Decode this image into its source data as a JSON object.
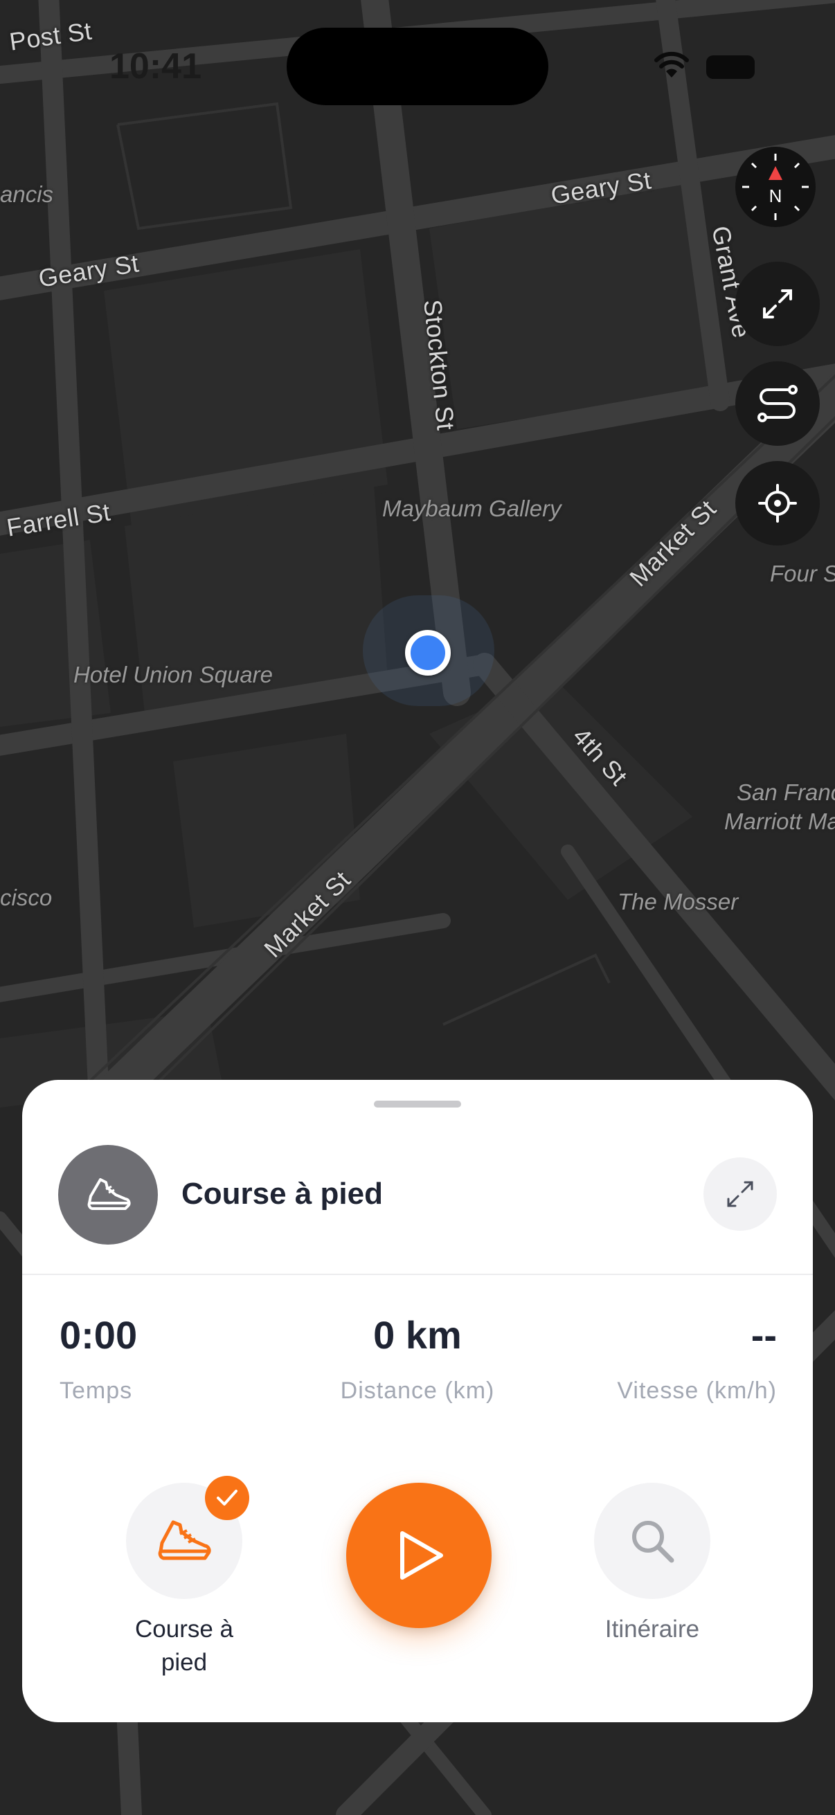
{
  "status_bar": {
    "time": "10:41"
  },
  "map": {
    "streets": [
      {
        "label": "Post St"
      },
      {
        "label": "Geary St"
      },
      {
        "label": "Geary St"
      },
      {
        "label": "Stockton St"
      },
      {
        "label": "Grant Ave"
      },
      {
        "label": "Farrell St"
      },
      {
        "label": "Market St"
      },
      {
        "label": "Market St"
      },
      {
        "label": "4th St"
      }
    ],
    "pois": [
      {
        "label": "Maybaum Gallery"
      },
      {
        "label": "Hotel Union Square"
      },
      {
        "label": "The Mosser"
      },
      {
        "label": "San Franc"
      },
      {
        "label": "Marriott Ma"
      },
      {
        "label": "Four S"
      },
      {
        "label": "ancis"
      },
      {
        "label": "cisco"
      }
    ],
    "compass_label": "N"
  },
  "sheet": {
    "activity_title": "Course à pied",
    "stats": [
      {
        "value": "0:00",
        "label": "Temps"
      },
      {
        "value": "0 km",
        "label": "Distance (km)"
      },
      {
        "value": "--",
        "label": "Vitesse (km/h)"
      }
    ],
    "actions": {
      "activity_label_line1": "Course à",
      "activity_label_line2": "pied",
      "route_label": "Itinéraire"
    }
  },
  "colors": {
    "accent": "#f97316",
    "location_dot": "#3b82f6",
    "map_background": "#262626",
    "sheet_background": "#ffffff",
    "text_primary": "#1f2433",
    "text_secondary": "#a3a8b3"
  },
  "icons": {
    "activity": "running-shoe-icon",
    "expand": "expand-arrows-icon",
    "route": "route-icon",
    "locate": "crosshair-icon",
    "compass": "compass-icon",
    "play": "play-icon",
    "search": "search-icon",
    "check": "checkmark-icon"
  }
}
